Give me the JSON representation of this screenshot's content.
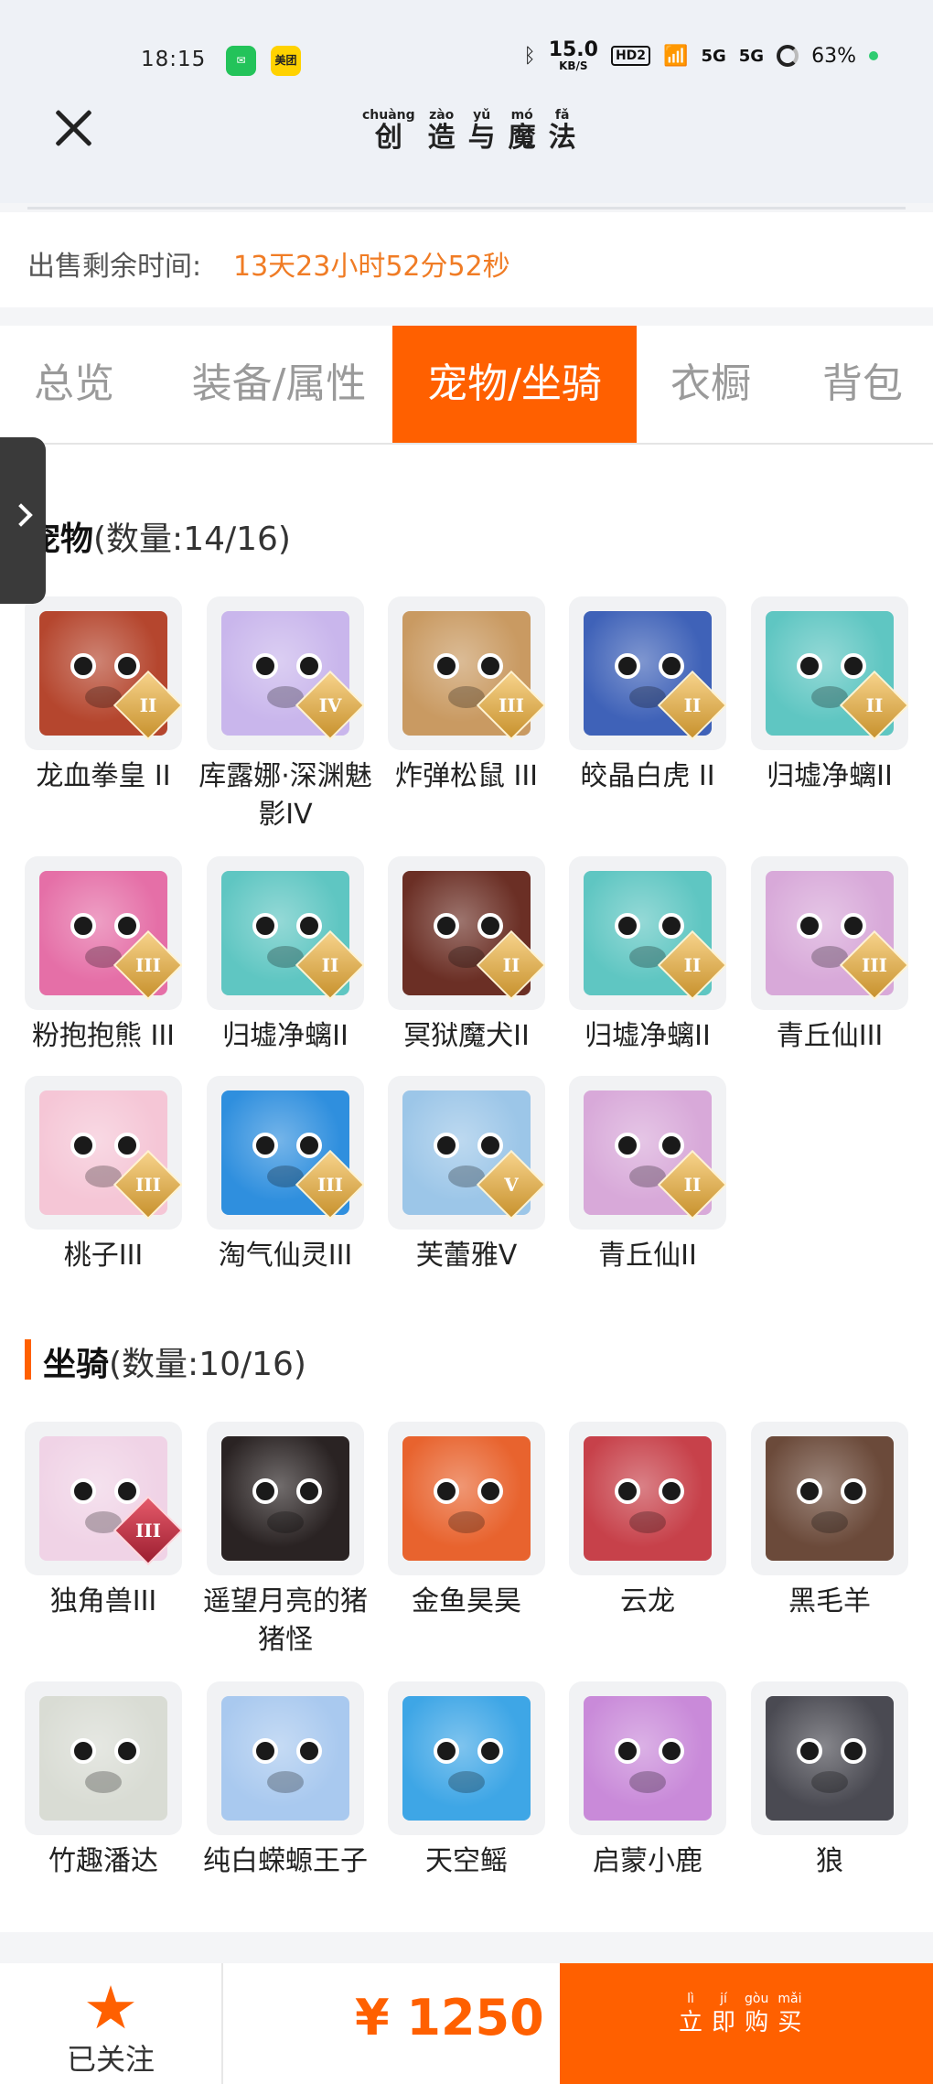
{
  "status_bar": {
    "time": "18:15",
    "app1": "微信",
    "app2": "美团",
    "speed_value": "15.0",
    "speed_unit": "KB/S",
    "hd": "HD2",
    "net1": "5G",
    "net2": "5G",
    "battery": "63%"
  },
  "header": {
    "title_chars": [
      {
        "py": "chuàng",
        "hz": "创"
      },
      {
        "py": "zào",
        "hz": "造"
      },
      {
        "py": "yǔ",
        "hz": "与"
      },
      {
        "py": "mó",
        "hz": "魔"
      },
      {
        "py": "fǎ",
        "hz": "法"
      }
    ]
  },
  "sale": {
    "label": "出售剩余时间:",
    "time": "13天23小时52分52秒"
  },
  "tabs": [
    {
      "label": "总览"
    },
    {
      "label": "装备/属性"
    },
    {
      "label": "宠物/坐骑"
    },
    {
      "label": "衣橱"
    },
    {
      "label": "背包"
    }
  ],
  "active_tab": "宠物/坐骑",
  "pets": {
    "heading": "宠物",
    "count": "(数量:14/16)",
    "items": [
      {
        "name": "龙血拳皇 II",
        "rank": "II",
        "color": "#b5462e"
      },
      {
        "name": "库露娜·深渊魅影IV",
        "rank": "IV",
        "color": "#c9b6ec"
      },
      {
        "name": "炸弹松鼠 III",
        "rank": "III",
        "color": "#c99a62"
      },
      {
        "name": "皎晶白虎 II",
        "rank": "II",
        "color": "#3f62b8"
      },
      {
        "name": "归墟净螭II",
        "rank": "II",
        "color": "#5fc6c2"
      },
      {
        "name": "粉抱抱熊 III",
        "rank": "III",
        "color": "#e56fa7"
      },
      {
        "name": "归墟净螭II",
        "rank": "II",
        "color": "#5fc6c2"
      },
      {
        "name": "冥狱魔犬II",
        "rank": "II",
        "color": "#6b2f25"
      },
      {
        "name": "归墟净螭II",
        "rank": "II",
        "color": "#5fc6c2"
      },
      {
        "name": "青丘仙III",
        "rank": "III",
        "color": "#d8a9d9"
      },
      {
        "name": "桃子III",
        "rank": "III",
        "color": "#f5c6d6"
      },
      {
        "name": "淘气仙灵III",
        "rank": "III",
        "color": "#2f8fde"
      },
      {
        "name": "芙蕾雅V",
        "rank": "V",
        "color": "#9cc6e8"
      },
      {
        "name": "青丘仙II",
        "rank": "II",
        "color": "#d8a9d9"
      }
    ]
  },
  "mounts": {
    "heading": "坐骑",
    "count": "(数量:10/16)",
    "items": [
      {
        "name": "独角兽III",
        "rank": "III",
        "color": "#f0d3e6"
      },
      {
        "name": "遥望月亮的猪猪怪",
        "rank": "",
        "color": "#2a2323"
      },
      {
        "name": "金鱼昊昊",
        "rank": "",
        "color": "#e8632e"
      },
      {
        "name": "云龙",
        "rank": "",
        "color": "#c7414a"
      },
      {
        "name": "黑毛羊",
        "rank": "",
        "color": "#6b4a3a"
      },
      {
        "name": "竹趣潘达",
        "rank": "",
        "color": "#d9dcd4"
      },
      {
        "name": "纯白蝾螈王子",
        "rank": "",
        "color": "#a9c9ef"
      },
      {
        "name": "天空鳐",
        "rank": "",
        "color": "#3ea6e6"
      },
      {
        "name": "启蒙小鹿",
        "rank": "",
        "color": "#c98ad9"
      },
      {
        "name": "狼",
        "rank": "",
        "color": "#4a4a52"
      }
    ]
  },
  "bottom": {
    "follow_label": "已关注",
    "price": "¥ 1250",
    "buy_chars": [
      {
        "py": "lì",
        "hz": "立"
      },
      {
        "py": "jí",
        "hz": "即"
      },
      {
        "py": "gòu",
        "hz": "购"
      },
      {
        "py": "mǎi",
        "hz": "买"
      }
    ]
  }
}
